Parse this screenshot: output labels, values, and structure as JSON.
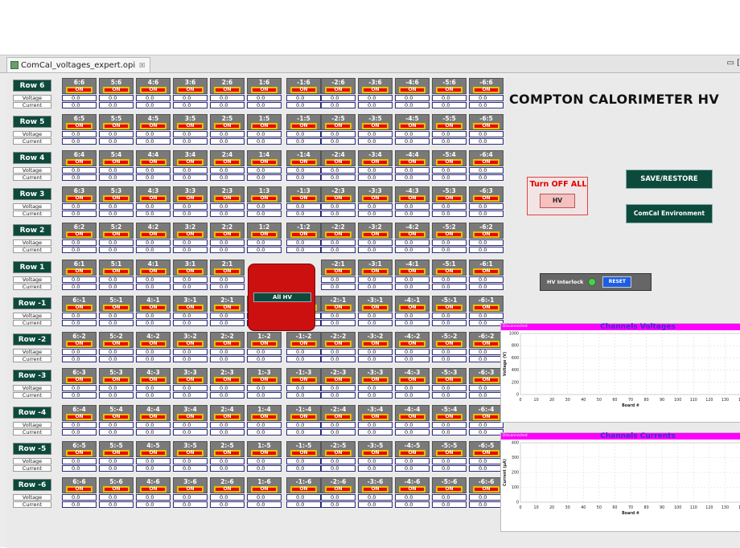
{
  "window": {
    "tab_title": "ComCal_voltages_expert.opi",
    "tab_close": "☒",
    "win_controls": "▭ ["
  },
  "labels": {
    "voltage": "Voltage",
    "current": "Current",
    "on": "ON",
    "zero": "0.0"
  },
  "rows": [
    "Row 6",
    "Row 5",
    "Row 4",
    "Row 3",
    "Row 2",
    "Row 1",
    "Row -1",
    "Row -2",
    "Row -3",
    "Row -4",
    "Row -5",
    "Row -6"
  ],
  "cols": [
    "6",
    "5",
    "4",
    "3",
    "2",
    "1",
    "-1",
    "-2",
    "-3",
    "-4",
    "-5",
    "-6"
  ],
  "all_hv": "All HV",
  "title": "COMPTON  CALORIMETER HV",
  "turn_off": {
    "label": "Turn OFF ALL",
    "button": "HV"
  },
  "save_restore": "SAVE/RESTORE",
  "environment": "ComCal Environment",
  "interlock": {
    "label": "HV Interlock",
    "reset": "RESET"
  },
  "colors": {
    "button_bg": "#0c4a3c",
    "on_red": "#e00000",
    "on_border": "#e6c200",
    "chart_header": "#ff00ff",
    "led_green": "#4cd14c"
  },
  "chart_data": [
    {
      "type": "scatter",
      "title": "Channels Voltages",
      "status": "Disconnected",
      "xlabel": "Board #",
      "ylabel": "Voltage (V)",
      "xlim": [
        0,
        140
      ],
      "ylim": [
        0,
        1000
      ],
      "x_ticks": [
        "0",
        "10",
        "20",
        "30",
        "40",
        "50",
        "60",
        "70",
        "80",
        "90",
        "100",
        "110",
        "120",
        "130",
        "14"
      ],
      "y_ticks": [
        "1000",
        "800",
        "600",
        "400",
        "200",
        "0"
      ],
      "grid": true,
      "series": []
    },
    {
      "type": "scatter",
      "title": "Channels Currents",
      "status": "Disconnected",
      "xlabel": "Board #",
      "ylabel": "Current (µA)",
      "xlim": [
        0,
        140
      ],
      "ylim": [
        0,
        400
      ],
      "x_ticks": [
        "0",
        "10",
        "20",
        "30",
        "40",
        "50",
        "60",
        "70",
        "80",
        "90",
        "100",
        "110",
        "120",
        "130",
        "14"
      ],
      "y_ticks": [
        "400",
        "300",
        "200",
        "100",
        "0"
      ],
      "grid": true,
      "series": []
    }
  ]
}
